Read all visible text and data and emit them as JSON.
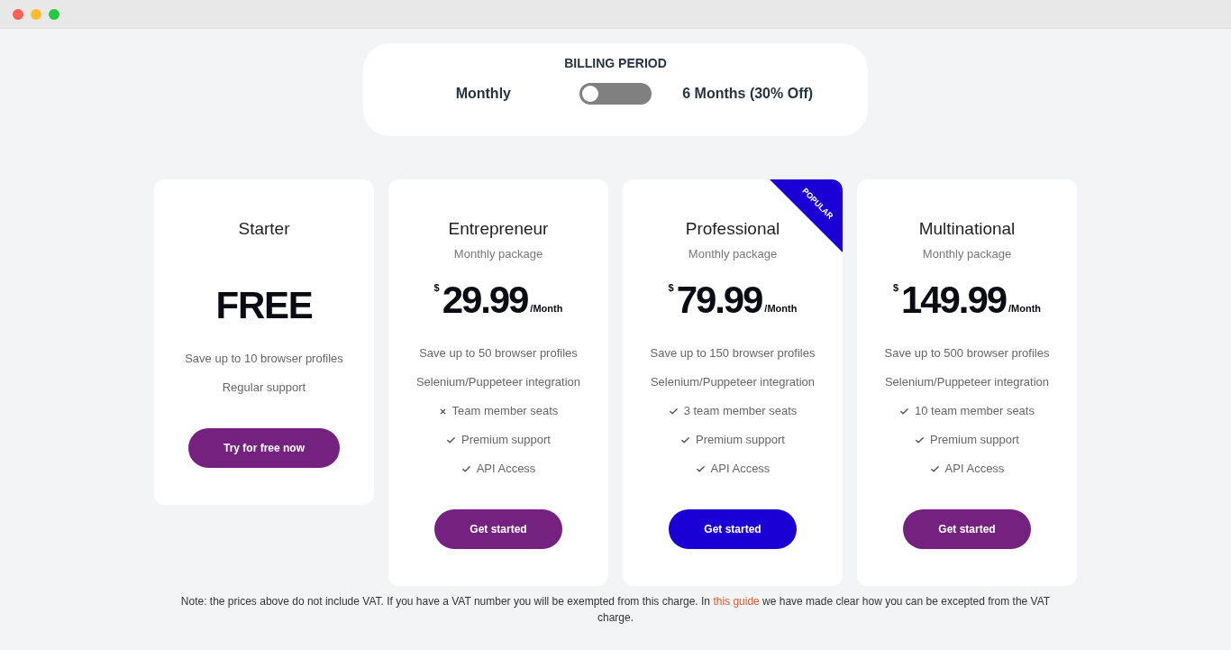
{
  "billing": {
    "title": "BILLING PERIOD",
    "options": [
      "Monthly",
      "6 Months (30% Off)"
    ],
    "toggle": {
      "on": false
    }
  },
  "plans": [
    {
      "name": "Starter",
      "price": {
        "amount": "FREE"
      },
      "features": [
        {
          "kind": "plain",
          "text": "Save up to 10 browser profiles"
        },
        {
          "kind": "plain",
          "text": "Regular support"
        }
      ],
      "button": "Try for free now",
      "featured": false
    },
    {
      "name": "Entrepreneur",
      "subtitle": "Monthly package",
      "price": {
        "currency": "$",
        "amount": "29.99",
        "period": "/Month"
      },
      "features": [
        {
          "kind": "plain",
          "text": "Save up to 50 browser profiles"
        },
        {
          "kind": "plain",
          "text": "Selenium/Puppeteer integration"
        },
        {
          "kind": "cross",
          "text": "Team member seats"
        },
        {
          "kind": "check",
          "text": "Premium support"
        },
        {
          "kind": "check",
          "text": "API Access"
        }
      ],
      "button": "Get started",
      "featured": false
    },
    {
      "name": "Professional",
      "subtitle": "Monthly package",
      "ribbon": "POPULAR",
      "price": {
        "currency": "$",
        "amount": "79.99",
        "period": "/Month"
      },
      "features": [
        {
          "kind": "plain",
          "text": "Save up to 150 browser profiles"
        },
        {
          "kind": "plain",
          "text": "Selenium/Puppeteer integration"
        },
        {
          "kind": "check",
          "text": "3 team member seats"
        },
        {
          "kind": "check",
          "text": "Premium support"
        },
        {
          "kind": "check",
          "text": "API Access"
        }
      ],
      "button": "Get started",
      "featured": true
    },
    {
      "name": "Multinational",
      "subtitle": "Monthly package",
      "price": {
        "currency": "$",
        "amount": "149.99",
        "period": "/Month"
      },
      "features": [
        {
          "kind": "plain",
          "text": "Save up to 500 browser profiles"
        },
        {
          "kind": "plain",
          "text": "Selenium/Puppeteer integration"
        },
        {
          "kind": "check",
          "text": "10 team member seats"
        },
        {
          "kind": "check",
          "text": "Premium support"
        },
        {
          "kind": "check",
          "text": "API Access"
        }
      ],
      "button": "Get started",
      "featured": false
    }
  ],
  "note": {
    "before": "Note: the prices above do not include VAT. If you have a VAT number you will be exempted from this charge. In ",
    "link": "this guide",
    "after": " we have made clear how you can be excepted from the VAT charge."
  }
}
